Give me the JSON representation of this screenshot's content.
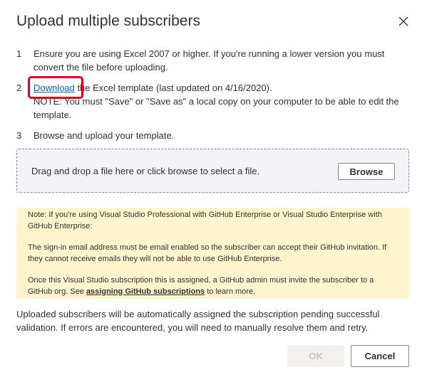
{
  "dialog": {
    "title": "Upload multiple subscribers",
    "close_icon": "close-icon"
  },
  "steps": [
    {
      "number": "1",
      "text": "Ensure you are using Excel 2007 or higher. If you're running a lower version you must convert the file before uploading."
    },
    {
      "number": "2",
      "link_label": "Download",
      "text_after_link": " the Excel template (last updated on 4/16/2020).",
      "note": "NOTE: You must \"Save\" or \"Save as\" a local copy on your computer to be able to edit the template."
    },
    {
      "number": "3",
      "text": "Browse and upload your template."
    }
  ],
  "dropzone": {
    "text": "Drag and drop a file here or click browse to select a file.",
    "browse_label": "Browse"
  },
  "notice": {
    "para1": "Note: If you're using Visual Studio Professional with GitHub Enterprise or Visual Studio Enterprise with GitHub Enterprise:",
    "para2": "The sign-in email address must be email enabled so the subscriber can accept their GitHub invitation. If they cannot receive emails they will not be able to use GitHub Enterprise.",
    "para3_before": "Once this Visual Studio subscription this is assigned, a GitHub admin must invite the subscriber to a GitHub org. See ",
    "para3_link": "assigning GitHub subscriptions",
    "para3_after": " to learn more."
  },
  "footer": {
    "text": "Uploaded subscribers will be automatically assigned the subscription pending successful validation. If errors are encountered, you will need to manually resolve them and retry.",
    "ok_label": "OK",
    "cancel_label": "Cancel"
  },
  "colors": {
    "highlight_border": "#e3001b",
    "link": "#0066cc",
    "notice_background": "#fff4ce",
    "dropzone_background": "#f4f3f7"
  }
}
